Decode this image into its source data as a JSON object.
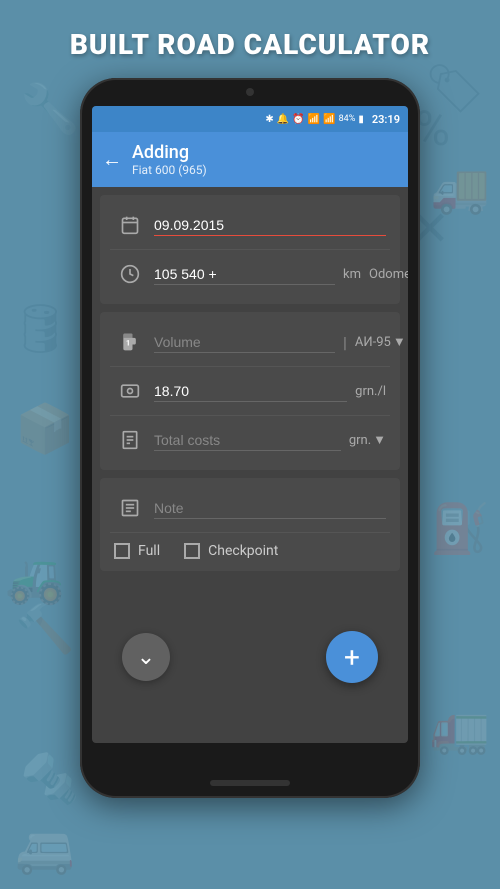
{
  "page": {
    "title": "BUILT ROAD CALCULATOR",
    "background_color": "#5b8fa8"
  },
  "status_bar": {
    "time": "23:19",
    "battery": "84%",
    "icons": [
      "bluetooth",
      "mute",
      "alarm",
      "wifi",
      "signal"
    ]
  },
  "header": {
    "back_label": "←",
    "title": "Adding",
    "subtitle": "Fiat 600 (965)"
  },
  "form": {
    "date_label": "09.09.2015",
    "date_placeholder": "09.09.2015",
    "odometer_value": "105 540 +",
    "odometer_unit": "km",
    "odometer_type": "Odome...",
    "odometer_dropdown_arrow": "▼",
    "volume_placeholder": "Volume",
    "volume_separator": "|",
    "fuel_type": "АИ-95",
    "fuel_dropdown_arrow": "▼",
    "price_value": "18.70",
    "price_unit": "grn./l",
    "total_placeholder": "Total costs",
    "total_unit": "grn.",
    "total_dropdown_arrow": "▼",
    "note_placeholder": "Note",
    "checkbox_full_label": "Full",
    "checkbox_checkpoint_label": "Checkpoint"
  },
  "buttons": {
    "down_icon": "⌄",
    "add_icon": "+"
  }
}
